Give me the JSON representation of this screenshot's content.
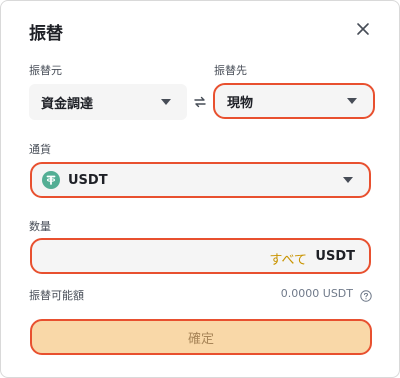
{
  "dialog": {
    "title": "振替",
    "close_icon": "close-icon"
  },
  "from": {
    "label": "振替元",
    "value": "資金調達"
  },
  "swap_icon": "swap-arrows-icon",
  "to": {
    "label": "振替先",
    "value": "現物"
  },
  "currency": {
    "label": "通貨",
    "value": "USDT",
    "icon": "tether-icon",
    "icon_color": "#53ae94"
  },
  "amount": {
    "label": "数量",
    "value": "",
    "all_label": "すべて",
    "unit": "USDT"
  },
  "available": {
    "label": "振替可能額",
    "value": "0.0000 USDT",
    "help_icon": "question-circle-icon"
  },
  "confirm_button": {
    "label": "確定"
  },
  "colors": {
    "highlight": "#e8502f",
    "accent": "#c99400",
    "button_bg": "#f9d8a8"
  }
}
